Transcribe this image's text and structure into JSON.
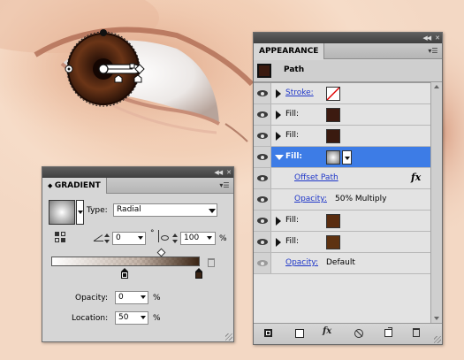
{
  "appearance": {
    "tab_label": "APPEARANCE",
    "title": "Path",
    "rows": [
      {
        "label": "Stroke:",
        "swatch": "none-red-slash",
        "link": true
      },
      {
        "label": "Fill:",
        "swatch": "#3c1a10"
      },
      {
        "label": "Fill:",
        "swatch": "#3a1a0f"
      },
      {
        "label": "Fill:",
        "swatch": "radial-gradient",
        "selected": true
      },
      {
        "label": "Offset Path",
        "link": true,
        "effect": true
      },
      {
        "label": "Opacity:",
        "value": "50% Multiply",
        "link": true
      },
      {
        "label": "Fill:",
        "swatch": "#5a2d10"
      },
      {
        "label": "Fill:",
        "swatch": "#5e3211"
      },
      {
        "label": "Opacity:",
        "value": "Default",
        "link": true
      }
    ],
    "fx_glyph": "fx",
    "footer_icons": [
      "add-new-stroke-icon",
      "add-new-fill-icon",
      "add-new-effect-icon",
      "clear-appearance-icon",
      "duplicate-item-icon",
      "delete-item-icon"
    ]
  },
  "gradient": {
    "tab_label": "GRADIENT",
    "type_label": "Type:",
    "type_value": "Radial",
    "angle_value": "0",
    "degree_symbol": "°",
    "aspect_value": "100",
    "percent_symbol": "%",
    "opacity_label": "Opacity:",
    "opacity_value": "0",
    "location_label": "Location:",
    "location_value": "50",
    "ramp_colors": [
      "#ffffff",
      "#3a2414"
    ]
  },
  "colors": {
    "selection": "#3d7ce6",
    "link": "#1f37c9",
    "iris": "#4a2410"
  }
}
